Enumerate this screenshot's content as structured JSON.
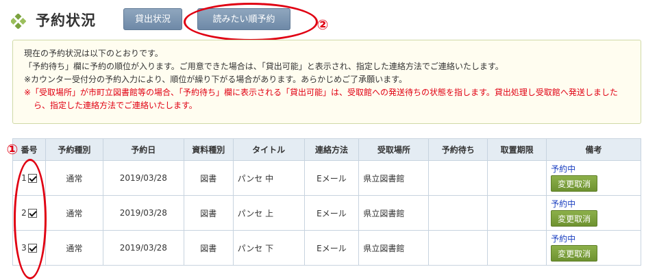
{
  "header": {
    "title": "予約状況",
    "tab_lending": "貸出状況",
    "tab_reserve": "読みたい順予約",
    "badge_2": "②"
  },
  "notice": {
    "lines": [
      "現在の予約状況は以下のとおりです。",
      "「予約待ち」欄に予約の順位が入ります。ご用意できた場合は、「貸出可能」と表示され、指定した連絡方法でご連絡いたします。",
      "※カウンター受付分の予約入力により、順位が繰り下がる場合があります。あらかじめご了承願います。"
    ],
    "red": "※「受取場所」が市町立図書館等の場合、「予約待ち」欄に表示される「貸出可能」は、受取館への発送待ちの状態を指します。貸出処理し受取館へ発送しましたら、指定した連絡方法でご連絡いたします。"
  },
  "table": {
    "headers": [
      "番号",
      "予約種別",
      "予約日",
      "資料種別",
      "タイトル",
      "連絡方法",
      "受取場所",
      "予約待ち",
      "取置期限",
      "備考"
    ],
    "rows": [
      {
        "no": "1",
        "type": "通常",
        "date": "2019/03/28",
        "material": "図書",
        "title": "パンセ 中",
        "contact": "Eメール",
        "place": "県立図書館",
        "wait": "",
        "limit": "",
        "status": "予約中",
        "button": "変更取消"
      },
      {
        "no": "2",
        "type": "通常",
        "date": "2019/03/28",
        "material": "図書",
        "title": "パンセ 上",
        "contact": "Eメール",
        "place": "県立図書館",
        "wait": "",
        "limit": "",
        "status": "予約中",
        "button": "変更取消"
      },
      {
        "no": "3",
        "type": "通常",
        "date": "2019/03/28",
        "material": "図書",
        "title": "パンセ 下",
        "contact": "Eメール",
        "place": "県立図書館",
        "wait": "",
        "limit": "",
        "status": "予約中",
        "button": "変更取消"
      }
    ]
  },
  "annotations": {
    "badge_1": "①"
  },
  "colors": {
    "accent_green": "#7ba23f",
    "tab_blue": "#7990ad",
    "annotation_red": "#e00012"
  },
  "icons": {
    "title_icon": "four-diamond-icon"
  }
}
